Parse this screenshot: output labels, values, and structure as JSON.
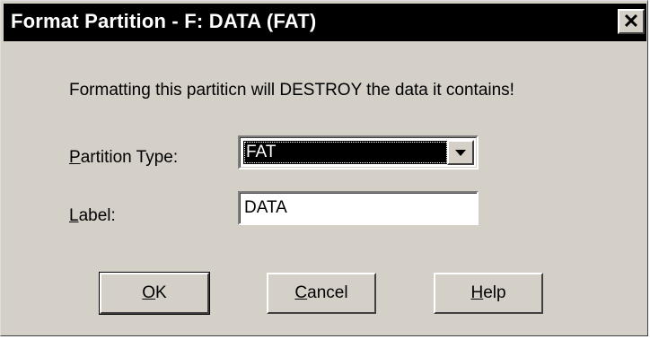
{
  "window": {
    "title": "Format Partition - F: DATA (FAT)",
    "close_symbol": "✕"
  },
  "message": "Formatting this partiticn will DESTROY the data it contains!",
  "partition_type": {
    "label_mnemonic": "P",
    "label_rest": "artition Type:",
    "selected": "FAT"
  },
  "label_field": {
    "label_mnemonic": "L",
    "label_rest": "abel:",
    "value": "DATA"
  },
  "buttons": {
    "ok_mnemonic": "O",
    "ok_rest": "K",
    "cancel_mnemonic": "C",
    "cancel_rest": "ancel",
    "help_mnemonic": "H",
    "help_rest": "elp"
  },
  "colors": {
    "face": "#d4d0c8",
    "titlebar": "#000000",
    "title_text": "#ffffff"
  }
}
